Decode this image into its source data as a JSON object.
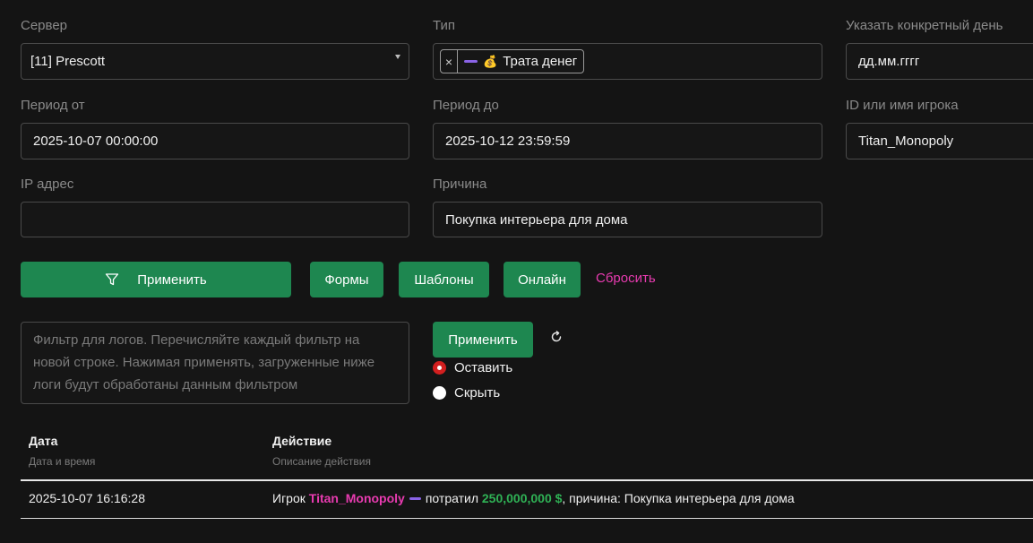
{
  "filters": {
    "server": {
      "label": "Сервер",
      "value": "[11] Prescott"
    },
    "type": {
      "label": "Тип",
      "tag_remove": "×",
      "tag_icon": "💰",
      "tag_label": "Трата денег"
    },
    "day": {
      "label": "Указать конкретный день",
      "placeholder": "дд.мм.гггг"
    },
    "period_from": {
      "label": "Период от",
      "value": "2025-10-07 00:00:00"
    },
    "period_to": {
      "label": "Период до",
      "value": "2025-10-12 23:59:59"
    },
    "player": {
      "label": "ID или имя игрока",
      "value": "Titan_Monopoly"
    },
    "ip": {
      "label": "IP адрес",
      "value": ""
    },
    "reason": {
      "label": "Причина",
      "value": "Покупка интерьера для дома"
    }
  },
  "actions": {
    "apply": "Применить",
    "forms": "Формы",
    "templates": "Шаблоны",
    "online": "Онлайн",
    "reset": "Сбросить"
  },
  "log_filter": {
    "placeholder": "Фильтр для логов. Перечисляйте каждый фильтр на новой строке. Нажимая применять, загруженные ниже логи будут обработаны данным фильтром",
    "apply": "Применить",
    "keep": "Оставить",
    "hide": "Скрыть"
  },
  "table": {
    "col_date": {
      "title": "Дата",
      "subtitle": "Дата и время"
    },
    "col_action": {
      "title": "Действие",
      "subtitle": "Описание действия"
    },
    "rows": [
      {
        "date": "2025-10-07 16:16:28",
        "prefix": "Игрок",
        "player": "Titan_Monopoly",
        "verb": "потратил",
        "amount": "250,000,000 $",
        "suffix": ", причина: Покупка интерьера для дома"
      }
    ]
  },
  "colors": {
    "background": "#141414",
    "accent_green": "#1e8750",
    "link_pink": "#e83bb0",
    "amount_green": "#2fb155",
    "tag_purple": "#8a63e6",
    "radio_red": "#d21f1f"
  }
}
